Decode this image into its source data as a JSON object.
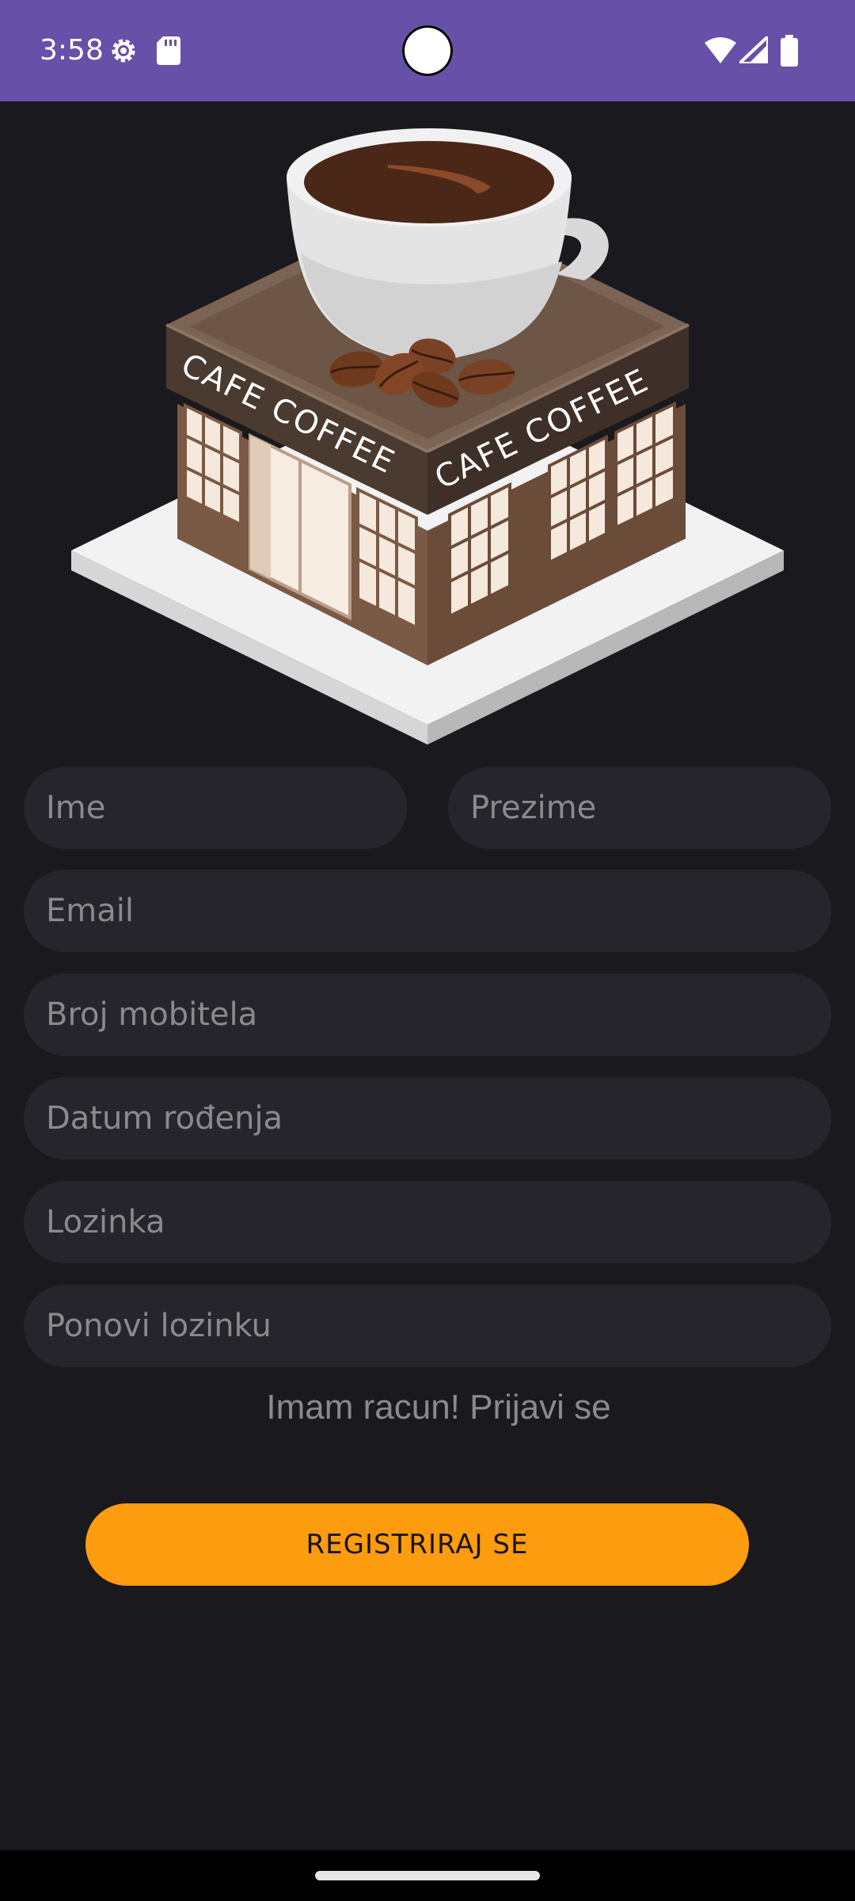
{
  "status_bar": {
    "time": "3:58",
    "icons": [
      "gear-icon",
      "sd-card-icon",
      "wifi-icon",
      "cellular-signal-icon",
      "battery-icon"
    ],
    "background_color": "#6750a8"
  },
  "hero": {
    "sign_left": "CAFE COFFEE",
    "sign_right": "CAFE COFFEE"
  },
  "form": {
    "first_name_placeholder": "Ime",
    "last_name_placeholder": "Prezime",
    "email_placeholder": "Email",
    "phone_placeholder": "Broj mobitela",
    "birthdate_placeholder": "Datum rođenja",
    "password_placeholder": "Lozinka",
    "repeat_password_placeholder": "Ponovi lozinku"
  },
  "login_link": "Imam racun! Prijavi se",
  "register_button": "REGISTRIRAJ SE",
  "colors": {
    "background": "#1a191e",
    "field_background": "#26252b",
    "accent": "#fc9c0e",
    "hint_text": "#8a8a8e"
  }
}
